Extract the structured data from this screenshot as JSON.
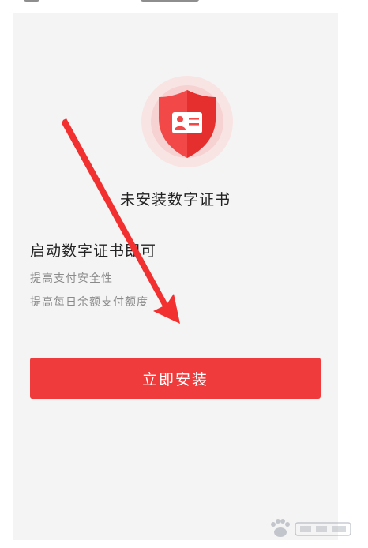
{
  "card": {
    "title": "未安装数字证书",
    "subtitle": "启动数字证书即可",
    "benefits": [
      "提高支付安全性",
      "提高每日余额支付额度"
    ],
    "install_button": "立即安装"
  },
  "colors": {
    "accent": "#ef3b3b",
    "card_bg": "#f4f4f4",
    "text_primary": "#222222",
    "text_secondary": "#8a8a8a",
    "shield_halo": "#f8dcdc",
    "arrow": "#f23030"
  },
  "icons": {
    "shield": "shield-id-card-icon",
    "arrow": "annotation-arrow",
    "watermark": "baidu-jingyan-logo"
  }
}
